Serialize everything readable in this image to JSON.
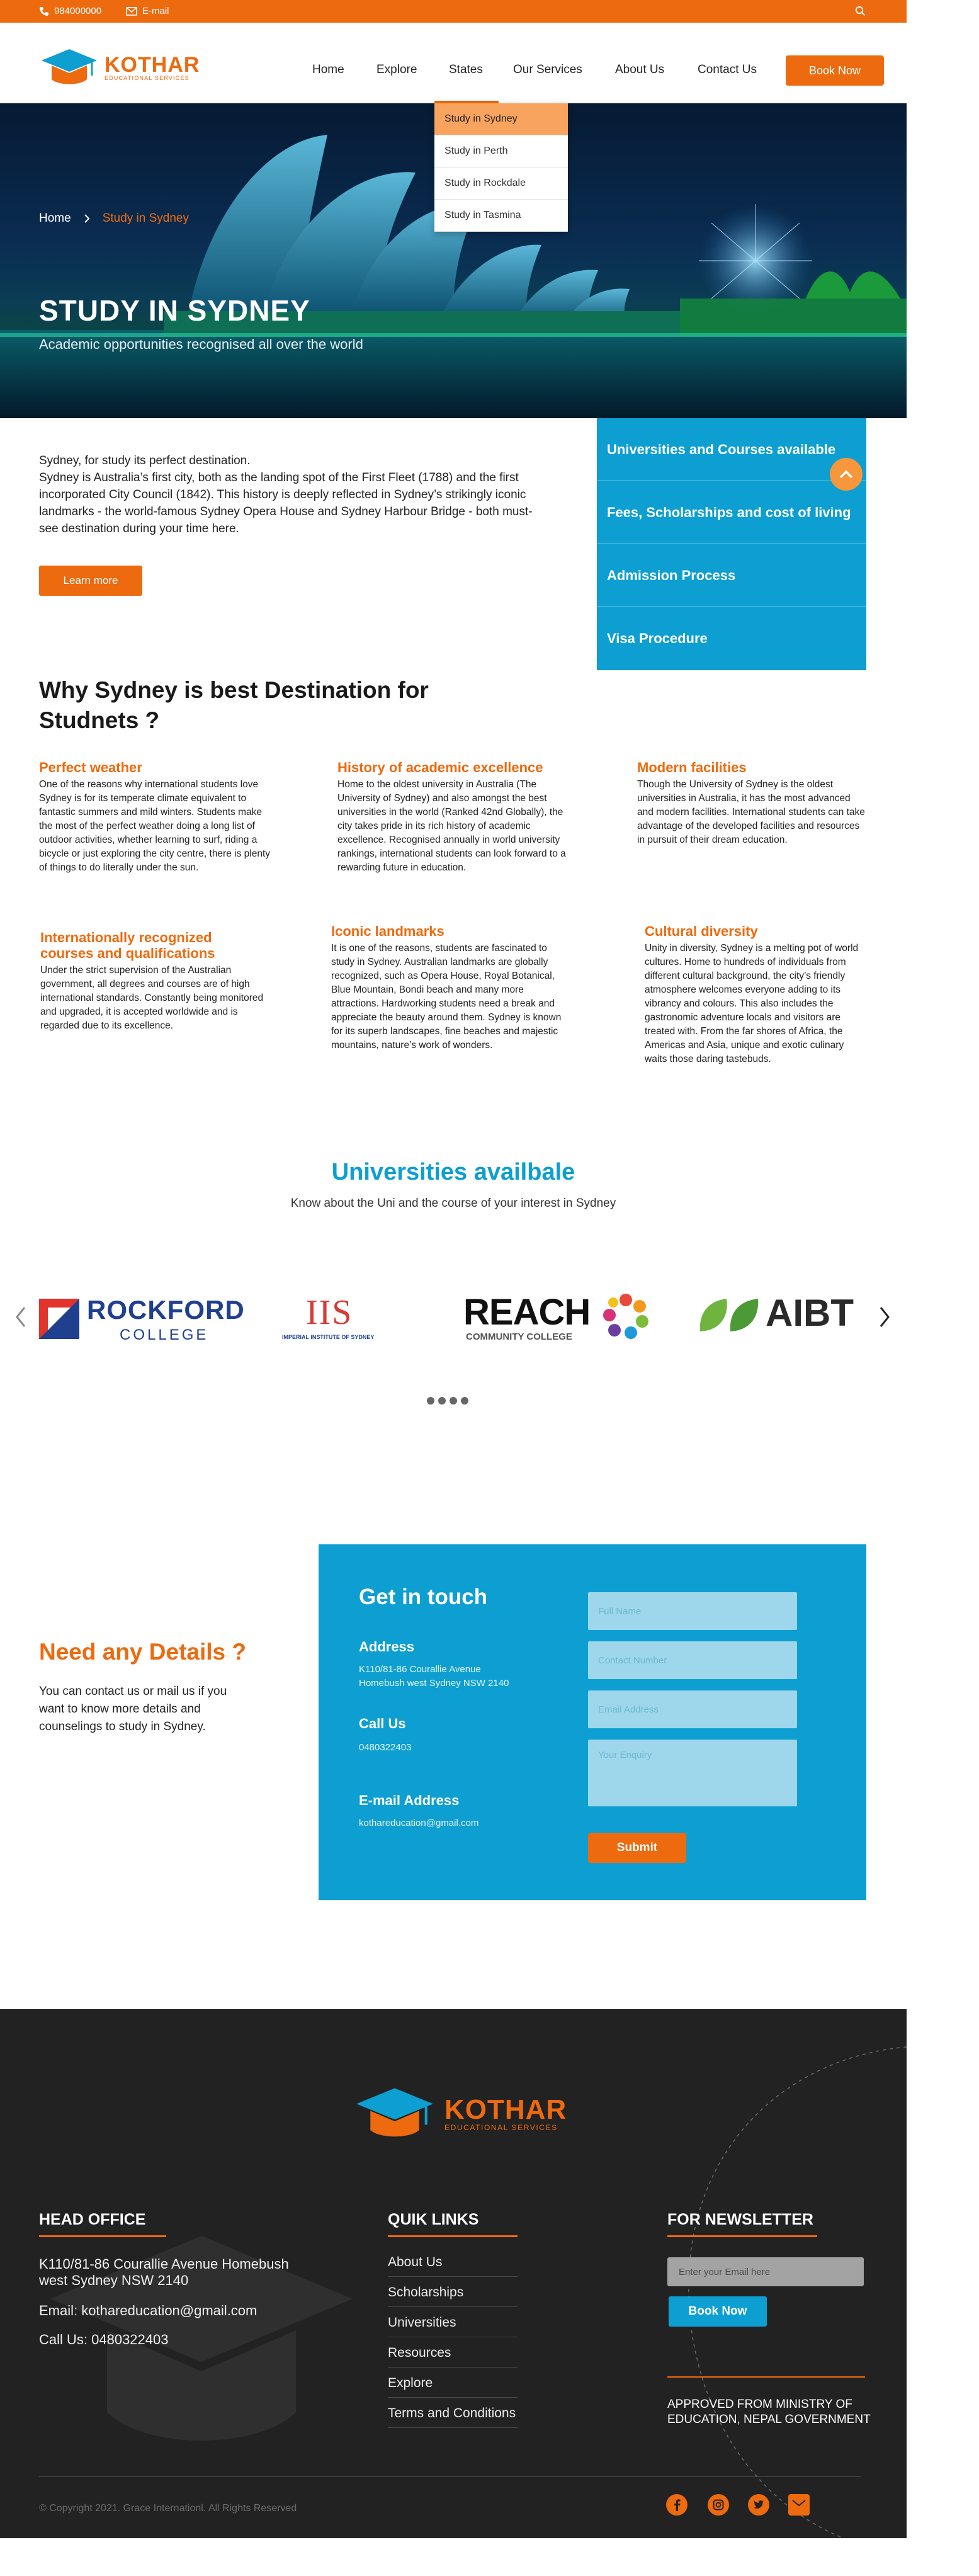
{
  "colors": {
    "accent": "#ee6a0f",
    "primary": "#0d9fd1",
    "footer_bg": "#222222"
  },
  "topbar": {
    "phone": "984000000",
    "email_label": "E-mail",
    "phone_icon": "phone-icon",
    "email_icon": "mail-icon",
    "search_icon": "search-icon"
  },
  "header": {
    "logo_name": "KOTHAR",
    "logo_sub": "EDUCATIONAL SERVICES",
    "nav": [
      "Home",
      "Explore",
      "States",
      "Our Services",
      "About Us",
      "Contact Us"
    ],
    "book_label": "Book Now"
  },
  "dropdown": [
    "Study in Sydney",
    "Study in Perth",
    "Study in Rockdale",
    "Study in Tasmina"
  ],
  "hero": {
    "crumb_home": "Home",
    "crumb_current": "Study in Sydney",
    "title": "STUDY IN SYDNEY",
    "subtitle": "Academic opportunities recognised all over the world"
  },
  "intro": {
    "line1": "Sydney, for study its perfect destination.",
    "body": "Sydney is Australia’s first city, both as the landing spot of the First Fleet (1788) and the first incorporated City Council (1842). This history is deeply reflected in Sydney’s strikingly iconic landmarks - the world-famous Sydney Opera House and Sydney Harbour Bridge - both must-see destination during your time here.",
    "button": "Learn more"
  },
  "side_menu": [
    "Universities and Courses available",
    "Fees, Scholarships and cost of living",
    "Admission Process",
    "Visa Procedure"
  ],
  "why": {
    "title": "Why Sydney is best Destination for Studnets ?",
    "features": [
      {
        "title": "Perfect weather",
        "text": "One of the reasons why international students love Sydney is for its temperate climate equivalent to fantastic summers and mild winters. Students make the most of the perfect weather doing a long list of outdoor activities, whether learning to surf, riding a bicycle or just exploring the city centre, there is plenty of things to do literally under the sun."
      },
      {
        "title": "History of academic excellence",
        "text": "Home to the oldest university in Australia (The University of Sydney) and also amongst the best universities in the world (Ranked 42nd Globally), the city takes pride in its rich history of academic excellence. Recognised annually in world university rankings, international students can look forward to a rewarding future in education."
      },
      {
        "title": "Modern facilities",
        "text": "Though the University of Sydney is the oldest universities in Australia, it has the most advanced and modern facilities. International students can take advantage of the developed facilities and resources in pursuit of their dream education."
      },
      {
        "title": "Internationally recognized courses and qualifications",
        "text": "Under the strict supervision of the Australian government, all degrees and courses are of high international standards. Constantly being monitored and upgraded, it is accepted worldwide and is regarded due to its excellence."
      },
      {
        "title": "Iconic landmarks",
        "text": "It is one of the reasons, students are fascinated to study in Sydney.  Australian landmarks are globally recognized, such as Opera House, Royal Botanical, Blue Mountain, Bondi beach and many more attractions. Hardworking students need a break and appreciate the beauty around them. Sydney is known for its superb landscapes, fine beaches and majestic mountains, nature’s work of wonders."
      },
      {
        "title": "Cultural diversity",
        "text": "Unity in diversity, Sydney is a melting pot of world cultures. Home to hundreds of individuals from different cultural background, the city’s friendly atmosphere welcomes everyone adding to its vibrancy and colours. This also includes the gastronomic adventure locals and visitors are treated with. From the far shores of Africa, the Americas and Asia, unique and exotic culinary waits those daring tastebuds."
      }
    ]
  },
  "universities": {
    "title": "Universities availbale",
    "subtitle": "Know about the Uni and the course of your interest in Sydney",
    "logos": [
      {
        "line1": "ROCKFORD",
        "line2": "COLLEGE"
      },
      {
        "line1": "IIS",
        "line2": "IMPERIAL INSTITUTE OF SYDNEY"
      },
      {
        "line1": "REACH",
        "line2": "COMMUNITY COLLEGE"
      },
      {
        "line1": "AIBT",
        "line2": ""
      }
    ]
  },
  "contact": {
    "need_title": "Need any Details ?",
    "need_text": "You can contact us or  mail us if you want to know more details and counselings to study in Sydney.",
    "card_title": "Get in touch",
    "address_label": "Address",
    "address_line1": "K110/81-86 Courallie Avenue",
    "address_line2": "Homebush west Sydney NSW 2140",
    "call_label": "Call Us",
    "call_value": "0480322403",
    "email_label": "E-mail Address",
    "email_value": "kothareducation@gmail.com",
    "placeholders": {
      "name": "Full Name",
      "contact": "Contact Number",
      "email": "Email Address",
      "enquiry": "Your Enquiry"
    },
    "submit": "Submit"
  },
  "footer": {
    "logo_name": "KOTHAR",
    "logo_sub": "EDUCATIONAL SERVICES",
    "office_head": "HEAD OFFICE",
    "office_address": "K110/81-86 Courallie Avenue Homebush west Sydney NSW 2140",
    "office_email": "Email: kothareducation@gmail.com",
    "office_call": "Call Us: 0480322403",
    "links_head": "QUIK LINKS",
    "links": [
      "About Us",
      "Scholarships",
      "Universities",
      "Resources",
      "Explore",
      "Terms and Conditions"
    ],
    "newsletter_head": "FOR NEWSLETTER",
    "newsletter_placeholder": "Enter your Email here",
    "newsletter_button": "Book Now",
    "approved": "APPROVED FROM MINISTRY OF EDUCATION, NEPAL GOVERNMENT",
    "copyright": "© Copyright 2021. Grace Internationl. All Rights Reserved",
    "social_icons": [
      "facebook-icon",
      "instagram-icon",
      "twitter-icon",
      "mail-icon"
    ]
  }
}
